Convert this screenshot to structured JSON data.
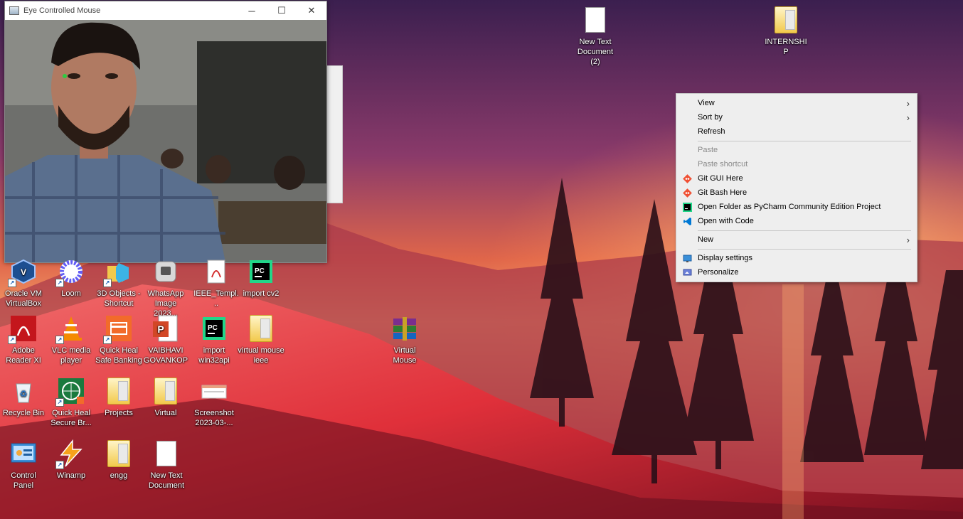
{
  "camera_window": {
    "title": "Eye Controlled Mouse",
    "minimize_glyph": "─",
    "maximize_glyph": "☐",
    "close_glyph": "✕"
  },
  "context_menu": {
    "items": [
      {
        "label": "View",
        "submenu": true,
        "disabled": false
      },
      {
        "label": "Sort by",
        "submenu": true,
        "disabled": false
      },
      {
        "label": "Refresh",
        "submenu": false,
        "disabled": false
      },
      {
        "label": "Paste",
        "submenu": false,
        "disabled": true
      },
      {
        "label": "Paste shortcut",
        "submenu": false,
        "disabled": true
      },
      {
        "label": "Git GUI Here",
        "icon": "git-gui-icon",
        "disabled": false
      },
      {
        "label": "Git Bash Here",
        "icon": "git-bash-icon",
        "disabled": false
      },
      {
        "label": "Open Folder as PyCharm Community Edition Project",
        "icon": "pycharm-icon",
        "disabled": false
      },
      {
        "label": "Open with Code",
        "icon": "vscode-icon",
        "disabled": false
      },
      {
        "label": "New",
        "submenu": true,
        "disabled": false
      },
      {
        "label": "Display settings",
        "icon": "display-icon",
        "disabled": false
      },
      {
        "label": "Personalize",
        "icon": "personalize-icon",
        "disabled": false
      }
    ],
    "submenu_arrow": "›"
  },
  "desktop_icons": {
    "top": [
      {
        "label": "New Text Document (2)",
        "icon": "text-document-icon"
      },
      {
        "label": "INTERNSHIP",
        "icon": "folder-icon"
      }
    ],
    "row1": [
      {
        "label": "Oracle VM VirtualBox",
        "icon": "virtualbox-icon"
      },
      {
        "label": "Loom",
        "icon": "loom-icon"
      },
      {
        "label": "3D Objects - Shortcut",
        "icon": "3d-objects-icon"
      },
      {
        "label": "WhatsApp Image 2023...",
        "icon": "image-icon"
      },
      {
        "label": "IEEE_Templ...",
        "icon": "pdf-icon"
      },
      {
        "label": "import cv2",
        "icon": "pycharm-icon"
      }
    ],
    "row2": [
      {
        "label": "Adobe Reader XI",
        "icon": "adobe-reader-icon"
      },
      {
        "label": "VLC media player",
        "icon": "vlc-icon"
      },
      {
        "label": "Quick Heal Safe Banking",
        "icon": "quick-heal-banking-icon"
      },
      {
        "label": "VAIBHAVI GOVANKOP",
        "icon": "powerpoint-icon"
      },
      {
        "label": "import win32api",
        "icon": "pycharm-icon"
      },
      {
        "label": "virtual mouse ieee",
        "icon": "folder-icon"
      },
      {
        "label": "Virtual Mouse",
        "icon": "winrar-icon"
      }
    ],
    "row3": [
      {
        "label": "Recycle Bin",
        "icon": "recycle-bin-icon"
      },
      {
        "label": "Quick Heal Secure Br...",
        "icon": "quick-heal-browser-icon"
      },
      {
        "label": "Projects",
        "icon": "folder-icon"
      },
      {
        "label": "Virtual",
        "icon": "folder-icon"
      },
      {
        "label": "Screenshot 2023-03-...",
        "icon": "screenshot-icon"
      }
    ],
    "row4": [
      {
        "label": "Control Panel",
        "icon": "control-panel-icon"
      },
      {
        "label": "Winamp",
        "icon": "winamp-icon"
      },
      {
        "label": "engg",
        "icon": "folder-icon"
      },
      {
        "label": "New Text Document",
        "icon": "text-document-icon"
      }
    ]
  },
  "colors": {
    "menu_bg": "#eeeeee",
    "menu_separator": "#c8c8c8",
    "disabled_text": "#8a8a8a",
    "sky_top": "#3b1f4f",
    "sky_horizon": "#f06a35",
    "snow_red": "#e0303a"
  }
}
